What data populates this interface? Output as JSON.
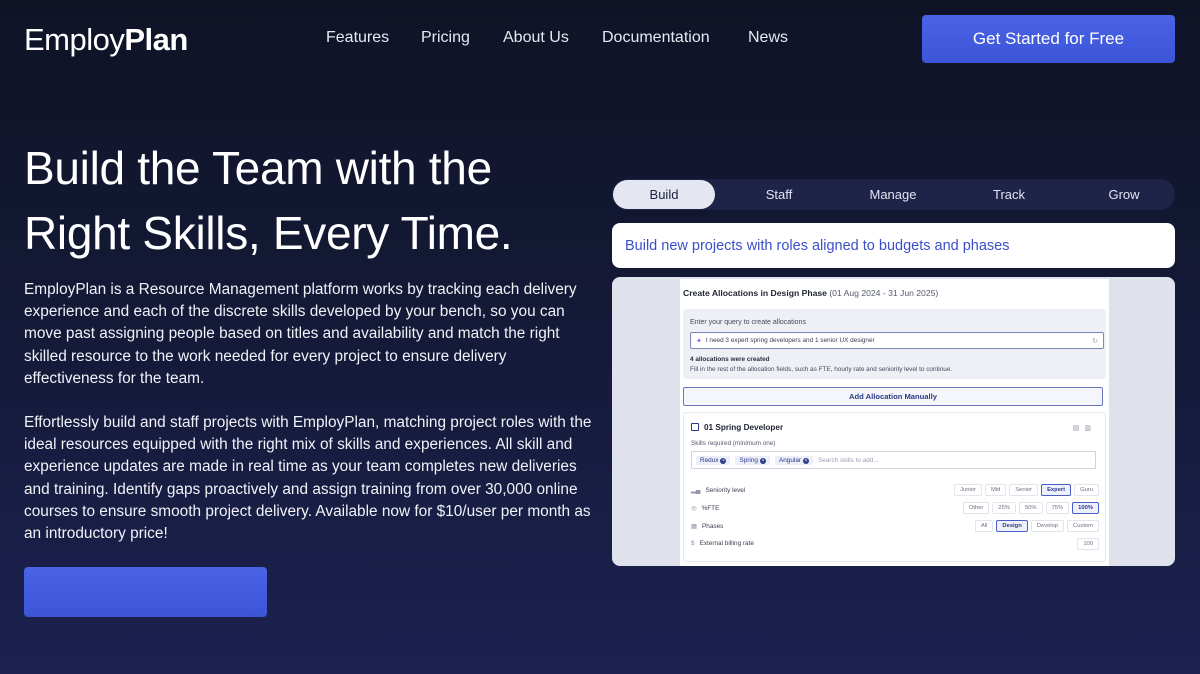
{
  "header": {
    "logo_light": "Employ",
    "logo_bold": "Plan",
    "nav": [
      "Features",
      "Pricing",
      "About Us",
      "Documentation",
      "News"
    ],
    "cta": "Get Started for Free"
  },
  "hero": {
    "title_line1": "Build the Team with the",
    "title_line2": "Right Skills, Every Time.",
    "paragraph1": "EmployPlan is a Resource Management platform works by tracking each delivery experience and each of the discrete skills developed by your bench, so you can move past assigning people based on titles and availability and match the right skilled resource to the work needed for every project to ensure delivery effectiveness for the team.",
    "paragraph2": "Effortlessly build and staff projects with EmployPlan, matching project roles with the ideal resources equipped with the right mix of skills and experiences. All skill and experience updates are made in real time as your team completes new deliveries and training. Identify gaps proactively and assign training from over 30,000 online courses to ensure smooth project delivery.  Available now for $10/user per month as an introductory price!"
  },
  "tabs": [
    "Build",
    "Staff",
    "Manage",
    "Track",
    "Grow"
  ],
  "active_tab": "Build",
  "banner": "Build new projects with roles aligned to budgets and phases",
  "preview": {
    "title": "Create Allocations in Design Phase",
    "title_range": "(01 Aug 2024 - 31 Jun 2025)",
    "query_label": "Enter your query to create allocations",
    "query_value": "I need 3 expert spring developers and 1 senior UX designer",
    "result_title": "4 allocations were created",
    "result_detail": "Fill in the rest of the allocation fields, such as FTE, hourly rate and seniority level to continue.",
    "add_button": "Add Allocation Manually",
    "role": {
      "title": "01 Spring Developer",
      "skills_label": "Skills required (minimum one)",
      "skills": [
        "Redux",
        "Spring",
        "Angular"
      ],
      "skills_placeholder": "Search skills to add...",
      "seniority_label": "Seniority level",
      "seniority_options": [
        "Junior",
        "Mid",
        "Senior",
        "Expert",
        "Guru"
      ],
      "seniority_selected": "Expert",
      "fte_label": "%FTE",
      "fte_options": [
        "Other",
        "25%",
        "50%",
        "75%",
        "100%"
      ],
      "fte_selected": "100%",
      "phases_label": "Phases",
      "phases_options": [
        "All",
        "Design",
        "Develop",
        "Custom"
      ],
      "phases_selected": "Design",
      "billing_label": "External billing rate",
      "billing_value": "100"
    }
  },
  "colors": {
    "accent": "#4a63e6",
    "background": "#141936",
    "banner_text": "#3b4fc9"
  }
}
